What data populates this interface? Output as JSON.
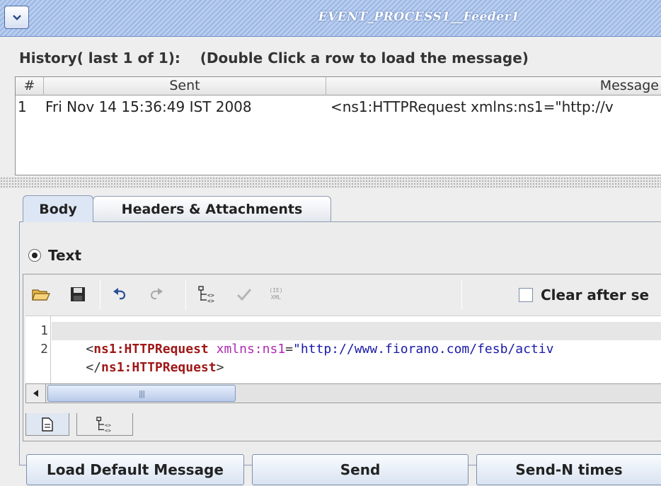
{
  "window": {
    "title": "EVENT_PROCESS1__Feeder1",
    "menu_icon": "chevron-down-icon"
  },
  "history": {
    "label": "History( last 1 of 1):    (Double Click a row to load the message)",
    "columns": [
      "#",
      "Sent",
      "Message"
    ],
    "rows": [
      {
        "num": "1",
        "sent": "Fri Nov 14 15:36:49 IST 2008",
        "message": "<ns1:HTTPRequest xmlns:ns1=\"http://v"
      }
    ]
  },
  "tabs": {
    "body": "Body",
    "headers": "Headers & Attachments",
    "active": "Body"
  },
  "radio": {
    "label": "Text",
    "selected": true
  },
  "toolbar": {
    "icons": [
      "open-folder-icon",
      "save-icon",
      "undo-icon",
      "redo-icon",
      "xml-tree-icon",
      "check-icon",
      "xml-format-icon"
    ],
    "xml_format_glyph_top": "(IE)",
    "xml_format_glyph_bottom": "XML",
    "clear_after_send_label": "Clear after se",
    "clear_after_send_checked": false
  },
  "editor": {
    "line_numbers": [
      "1",
      "2"
    ],
    "line1": {
      "open": "<",
      "tag": "ns1:HTTPRequest",
      "space": " ",
      "attr": "xmlns:ns1",
      "eq": "=",
      "value": "\"http://www.fiorano.com/fesb/activ"
    },
    "line2": {
      "open": "</",
      "tag": "ns1:HTTPRequest",
      "close": ">"
    }
  },
  "scrollbar": {
    "thumb_grip": "|||"
  },
  "editor_tabs": [
    "text-view-icon",
    "tree-view-icon"
  ],
  "buttons": {
    "load_default": "Load Default Message",
    "send": "Send",
    "send_n": "Send-N times"
  },
  "colors": {
    "titlebar": "#9bb7e3",
    "xml_tag": "#a01818",
    "xml_attr": "#b02ab4",
    "xml_value": "#1a1aa8"
  }
}
